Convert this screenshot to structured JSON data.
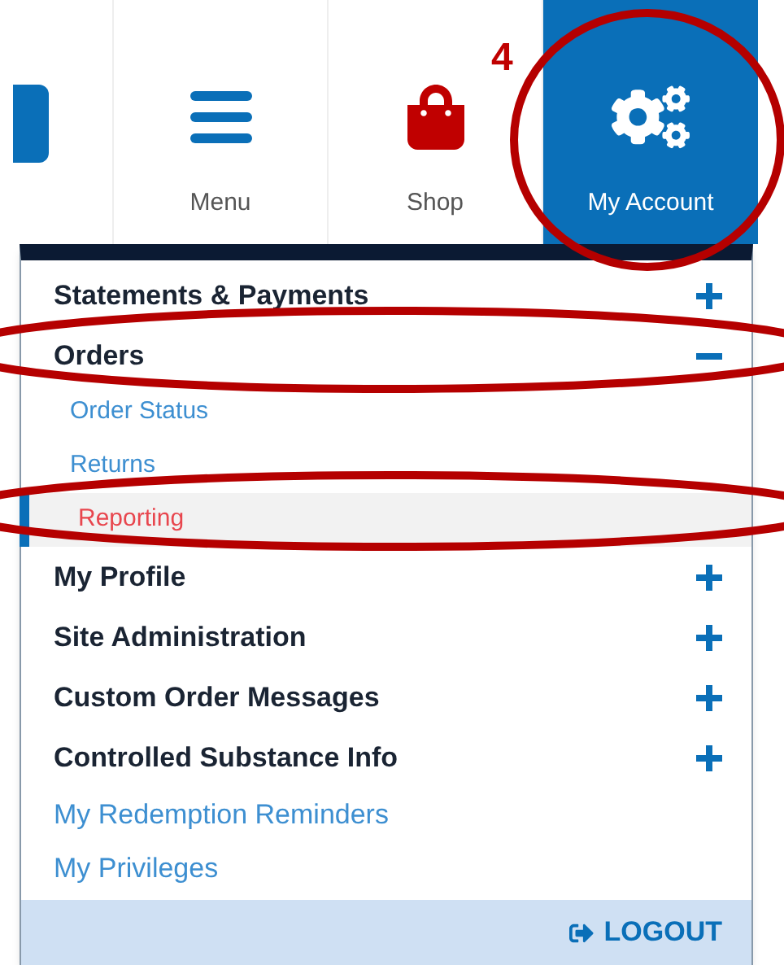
{
  "nav": [
    {
      "kind": "partial"
    },
    {
      "kind": "menu",
      "label": "Menu",
      "selected": false
    },
    {
      "kind": "shop",
      "label": "Shop",
      "selected": false
    },
    {
      "kind": "account",
      "label": "My Account",
      "selected": true
    }
  ],
  "annotation": {
    "label": "4"
  },
  "dropdown": {
    "items": [
      {
        "kind": "group",
        "label": "Statements & Payments",
        "expanded": false
      },
      {
        "kind": "group",
        "label": "Orders",
        "expanded": true,
        "children": [
          {
            "label": "Order Status",
            "selected": false
          },
          {
            "label": "Returns",
            "selected": false
          },
          {
            "label": "Reporting",
            "selected": true
          }
        ]
      },
      {
        "kind": "group",
        "label": "My Profile",
        "expanded": false
      },
      {
        "kind": "group",
        "label": "Site Administration",
        "expanded": false
      },
      {
        "kind": "group",
        "label": "Custom Order Messages",
        "expanded": false
      },
      {
        "kind": "group",
        "label": "Controlled Substance Info",
        "expanded": false
      },
      {
        "kind": "link",
        "label": "My Redemption Reminders"
      },
      {
        "kind": "link",
        "label": "My Privileges"
      }
    ],
    "logout": "LOGOUT"
  }
}
